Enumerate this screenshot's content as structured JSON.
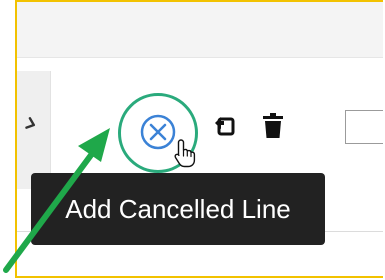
{
  "toolbar": {
    "cancel_button_icon": "circle-x-icon",
    "undo_button_icon": "undo-icon",
    "delete_button_icon": "trash-icon",
    "collapse_icon": "chevron-down-icon"
  },
  "tooltip": {
    "text": "Add Cancelled Line"
  },
  "colors": {
    "frame_border": "#f2c200",
    "highlight_ring": "#2aaa7c",
    "arrow": "#1fa84a",
    "tooltip_bg": "#222222",
    "icon_blue": "#3b82d6"
  }
}
